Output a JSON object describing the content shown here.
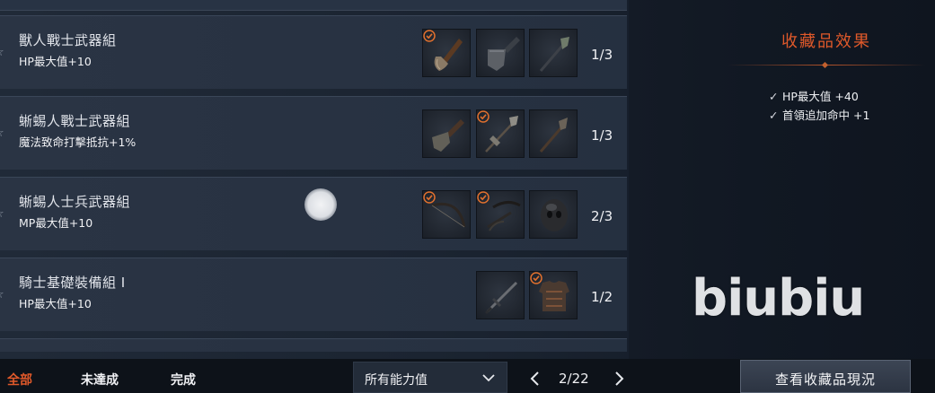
{
  "collections": [
    {
      "name": "獸人戰士武器組",
      "effect": "HP最大值+10",
      "progress": "1/3",
      "items": [
        {
          "icon": "axe-icon",
          "owned": true
        },
        {
          "icon": "cleaver-icon",
          "owned": false
        },
        {
          "icon": "spear-icon",
          "owned": false
        }
      ]
    },
    {
      "name": "蜥蜴人戰士武器組",
      "effect": "魔法致命打擊抵抗+1%",
      "progress": "1/3",
      "items": [
        {
          "icon": "cleaver-icon",
          "owned": false
        },
        {
          "icon": "polearm-icon",
          "owned": true
        },
        {
          "icon": "spear-icon",
          "owned": false
        }
      ]
    },
    {
      "name": "蜥蜴人士兵武器組",
      "effect": "MP最大值+10",
      "progress": "2/3",
      "items": [
        {
          "icon": "bow-icon",
          "owned": true
        },
        {
          "icon": "crossbow-icon",
          "owned": true
        },
        {
          "icon": "helmet-icon",
          "owned": false
        }
      ]
    },
    {
      "name": "騎士基礎裝備組 I",
      "effect": "HP最大值+10",
      "progress": "1/2",
      "items": [
        {
          "icon": "sword-icon",
          "owned": false
        },
        {
          "icon": "armor-icon",
          "owned": true
        }
      ]
    }
  ],
  "panel": {
    "title": "收藏品效果",
    "effects": [
      "HP最大值 +40",
      "首領追加命中 +1"
    ]
  },
  "filters": {
    "tabs": [
      {
        "label": "全部",
        "active": true
      },
      {
        "label": "未達成",
        "active": false
      },
      {
        "label": "完成",
        "active": false
      }
    ],
    "dropdown_value": "所有能力值"
  },
  "pager": {
    "text": "2/22"
  },
  "view_button": "查看收藏品現況",
  "watermark": "biubiu",
  "colors": {
    "accent": "#e0592a",
    "check": "#e0702e"
  }
}
